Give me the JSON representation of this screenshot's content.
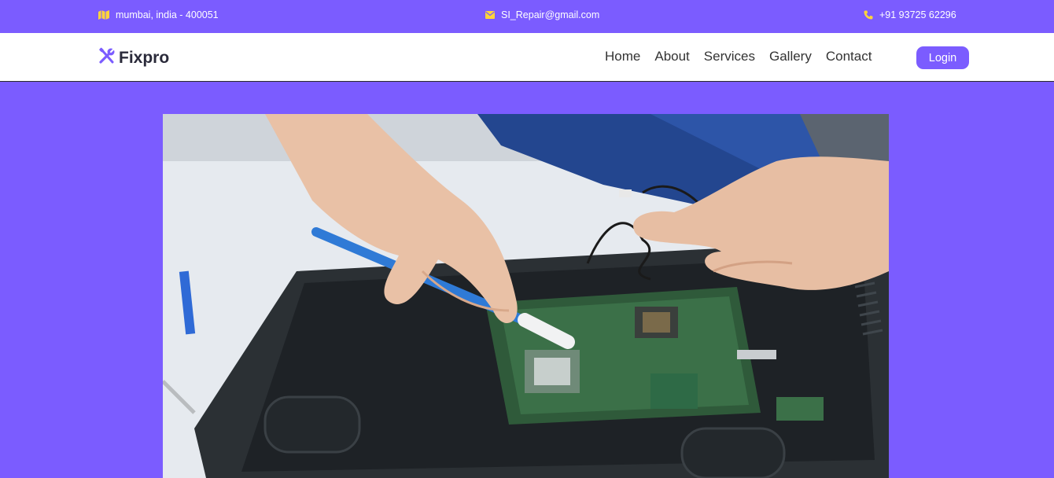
{
  "topbar": {
    "address": {
      "icon": "map-icon",
      "text": "mumbai, india - 400051"
    },
    "email": {
      "icon": "envelope-icon",
      "text": "SI_Repair@gmail.com"
    },
    "phone": {
      "icon": "phone-icon",
      "text": "+91 93725 62296"
    }
  },
  "navbar": {
    "brand": {
      "icon": "tools-icon",
      "text": "Fixpro"
    },
    "links": [
      "Home",
      "About",
      "Services",
      "Gallery",
      "Contact"
    ],
    "login_label": "Login"
  },
  "hero": {
    "image": "laptop-repair-photo"
  },
  "colors": {
    "primary": "#7b5cff",
    "icon_accent": "#ffd43b",
    "text_dark": "#333333",
    "nav_bg": "#ffffff"
  }
}
